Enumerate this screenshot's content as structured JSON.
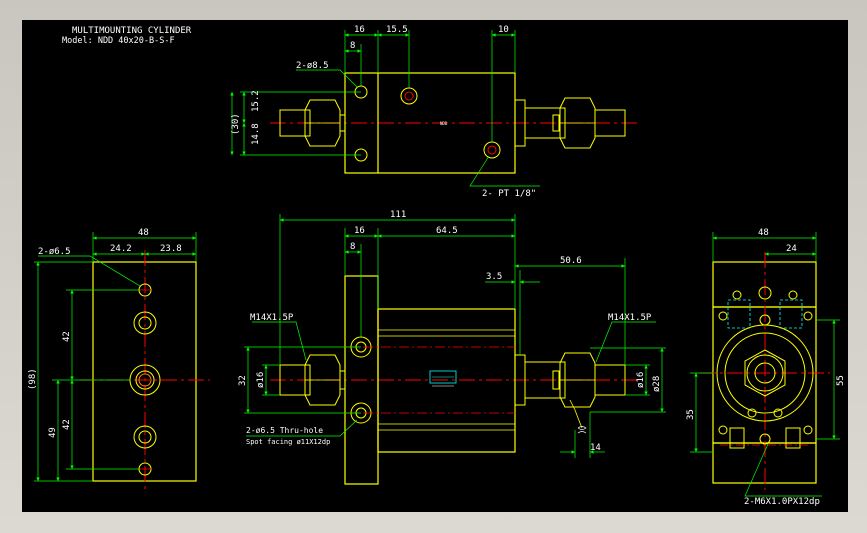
{
  "title": {
    "line1": "MULTIMOUNTING CYLINDER",
    "line2": "Model: NDD 40x20-B-S-F"
  },
  "colors": {
    "background": "#000000",
    "outline": "#ffff00",
    "dimension": "#00ff00",
    "center_line": "#ff0000",
    "hidden": "#00ffff",
    "text": "#ffffff"
  },
  "top_view": {
    "dims": {
      "d16": "16",
      "d15_5": "15.5",
      "d10": "10",
      "d8": "8",
      "d15_2": "15.2",
      "d14_8": "14.8",
      "d30": "(30)"
    },
    "labels": {
      "hole": "2-ø8.5",
      "port": "2- PT 1/8\""
    }
  },
  "front_view": {
    "dims": {
      "d111": "111",
      "d16": "16",
      "d64_5": "64.5",
      "d8": "8",
      "d3_5": "3.5",
      "d50_6": "50.6",
      "d32": "32",
      "phi16_left": "ø16",
      "phi16_right": "ø16",
      "phi28": "ø28",
      "d14": "14"
    },
    "labels": {
      "thread_left": "M14X1.5P",
      "thread_right": "M14X1.5P",
      "hole_note1": "2-ø6.5 Thru-hole",
      "hole_note2": "Spot facing ø11X12dp"
    }
  },
  "left_view": {
    "dims": {
      "d48": "48",
      "d24_2": "24.2",
      "d23_8": "23.8",
      "d42_top": "42",
      "d42_bottom": "42",
      "d49": "49",
      "d98": "(98)"
    },
    "labels": {
      "hole": "2-ø6.5"
    }
  },
  "right_view": {
    "dims": {
      "d48": "48",
      "d24": "24",
      "d55": "55",
      "d35": "35"
    },
    "labels": {
      "thread": "2-M6X1.0PX12dp"
    }
  }
}
